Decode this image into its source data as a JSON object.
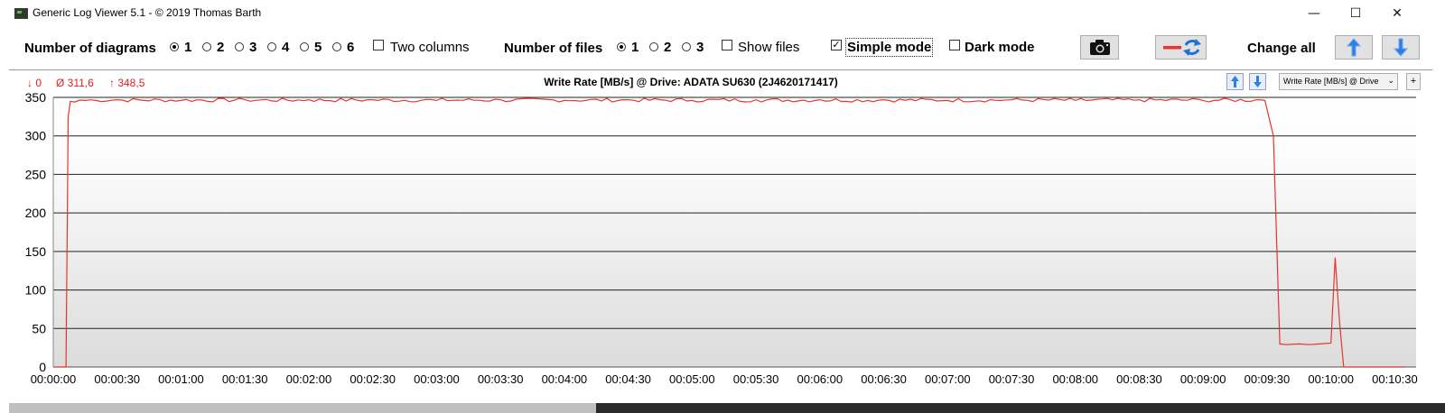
{
  "window": {
    "title": "Generic Log Viewer 5.1 - © 2019 Thomas Barth",
    "minimize": "—",
    "maximize": "☐",
    "close": "✕"
  },
  "toolbar": {
    "num_diagrams_label": "Number of diagrams",
    "diagram_options": [
      "1",
      "2",
      "3",
      "4",
      "5",
      "6"
    ],
    "diagram_selected": "1",
    "two_columns_label": "Two columns",
    "two_columns_checked": false,
    "num_files_label": "Number of files",
    "file_options": [
      "1",
      "2",
      "3"
    ],
    "file_selected": "1",
    "show_files_label": "Show files",
    "show_files_checked": false,
    "simple_mode_label": "Simple mode",
    "simple_mode_checked": true,
    "dark_mode_label": "Dark mode",
    "dark_mode_checked": false,
    "change_all_label": "Change all"
  },
  "stats": {
    "min": "↓ 0",
    "avg": "Ø 311,6",
    "max": "↑ 348,5"
  },
  "series_select": "Write Rate [MB/s] @ Drive",
  "plus_label": "+",
  "colors": {
    "line": "#e8332f",
    "stats": "#e02020",
    "button_accent": "#1f6fd6"
  },
  "chart_data": {
    "type": "line",
    "title": "Write Rate [MB/s] @ Drive: ADATA SU630 (2J4620171417)",
    "xlabel": "",
    "ylabel": "",
    "ylim": [
      0,
      350
    ],
    "yticks": [
      "0",
      "50",
      "100",
      "150",
      "200",
      "250",
      "300",
      "350"
    ],
    "xlim_seconds": [
      0,
      640
    ],
    "xticks": [
      "00:00:00",
      "00:00:30",
      "00:01:00",
      "00:01:30",
      "00:02:00",
      "00:02:30",
      "00:03:00",
      "00:03:30",
      "00:04:00",
      "00:04:30",
      "00:05:00",
      "00:05:30",
      "00:06:00",
      "00:06:30",
      "00:07:00",
      "00:07:30",
      "00:08:00",
      "00:08:30",
      "00:09:00",
      "00:09:30",
      "00:10:00",
      "00:10:30"
    ],
    "grid": true,
    "series": [
      {
        "x": [
          "00:00:00",
          "00:00:02",
          "00:00:04",
          "00:00:06",
          "00:00:07",
          "00:00:08",
          "00:00:10",
          "00:00:15",
          "00:00:20",
          "00:00:30",
          "00:01:00",
          "00:01:30",
          "00:02:00",
          "00:02:30",
          "00:03:00",
          "00:03:30",
          "00:04:00",
          "00:04:30",
          "00:05:00",
          "00:05:30",
          "00:06:00",
          "00:06:30",
          "00:07:00",
          "00:07:30",
          "00:08:00",
          "00:08:30",
          "00:09:00",
          "00:09:25",
          "00:09:29",
          "00:09:33",
          "00:09:36",
          "00:09:39",
          "00:09:45",
          "00:09:50",
          "00:09:55",
          "00:10:00",
          "00:10:02",
          "00:10:04",
          "00:10:06",
          "00:10:30",
          "00:10:35"
        ],
        "y": [
          0,
          0,
          0,
          0,
          325,
          345,
          344,
          346,
          346,
          347,
          346,
          347,
          347,
          347,
          346,
          347,
          346,
          347,
          346,
          347,
          347,
          347,
          346,
          347,
          346,
          347,
          346,
          347,
          346,
          300,
          30,
          29,
          30,
          29,
          30,
          31,
          142,
          60,
          0,
          0,
          0
        ]
      }
    ]
  }
}
